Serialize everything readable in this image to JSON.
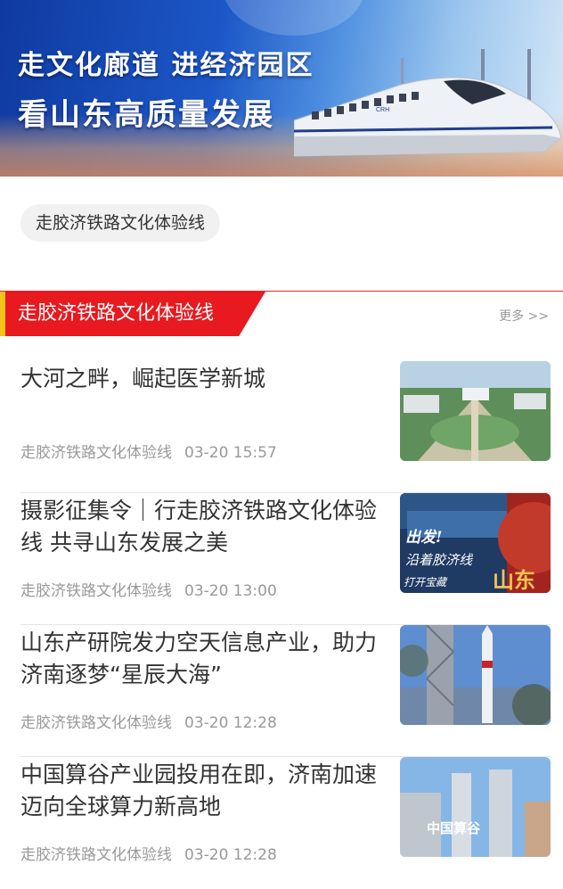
{
  "banner": {
    "line1": "走文化廊道 进经济园区",
    "line2": "看山东高质量发展",
    "train_badge": "CRH"
  },
  "tag_chip": "走胶济铁路文化体验线",
  "section": {
    "title": "走胶济铁路文化体验线",
    "more": "更多 >>",
    "accent_color": "#e8191f"
  },
  "articles": [
    {
      "title": "大河之畔，崛起医学新城",
      "source": "走胶济铁路文化体验线",
      "time": "03-20 15:57"
    },
    {
      "title": "摄影征集令｜行走胶济铁路文化体验线 共寻山东发展之美",
      "source": "走胶济铁路文化体验线",
      "time": "03-20 13:00",
      "thumb_text": {
        "line1": "出发!",
        "line2": "沿着胶济线",
        "line3": "打开宝藏",
        "big": "山东"
      }
    },
    {
      "title": "山东产研院发力空天信息产业，助力济南逐梦“星辰大海”",
      "source": "走胶济铁路文化体验线",
      "time": "03-20 12:28"
    },
    {
      "title": "中国算谷产业园投用在即，济南加速迈向全球算力新高地",
      "source": "走胶济铁路文化体验线",
      "time": "03-20 12:28",
      "thumb_text": {
        "logo": "中国算谷"
      }
    }
  ]
}
